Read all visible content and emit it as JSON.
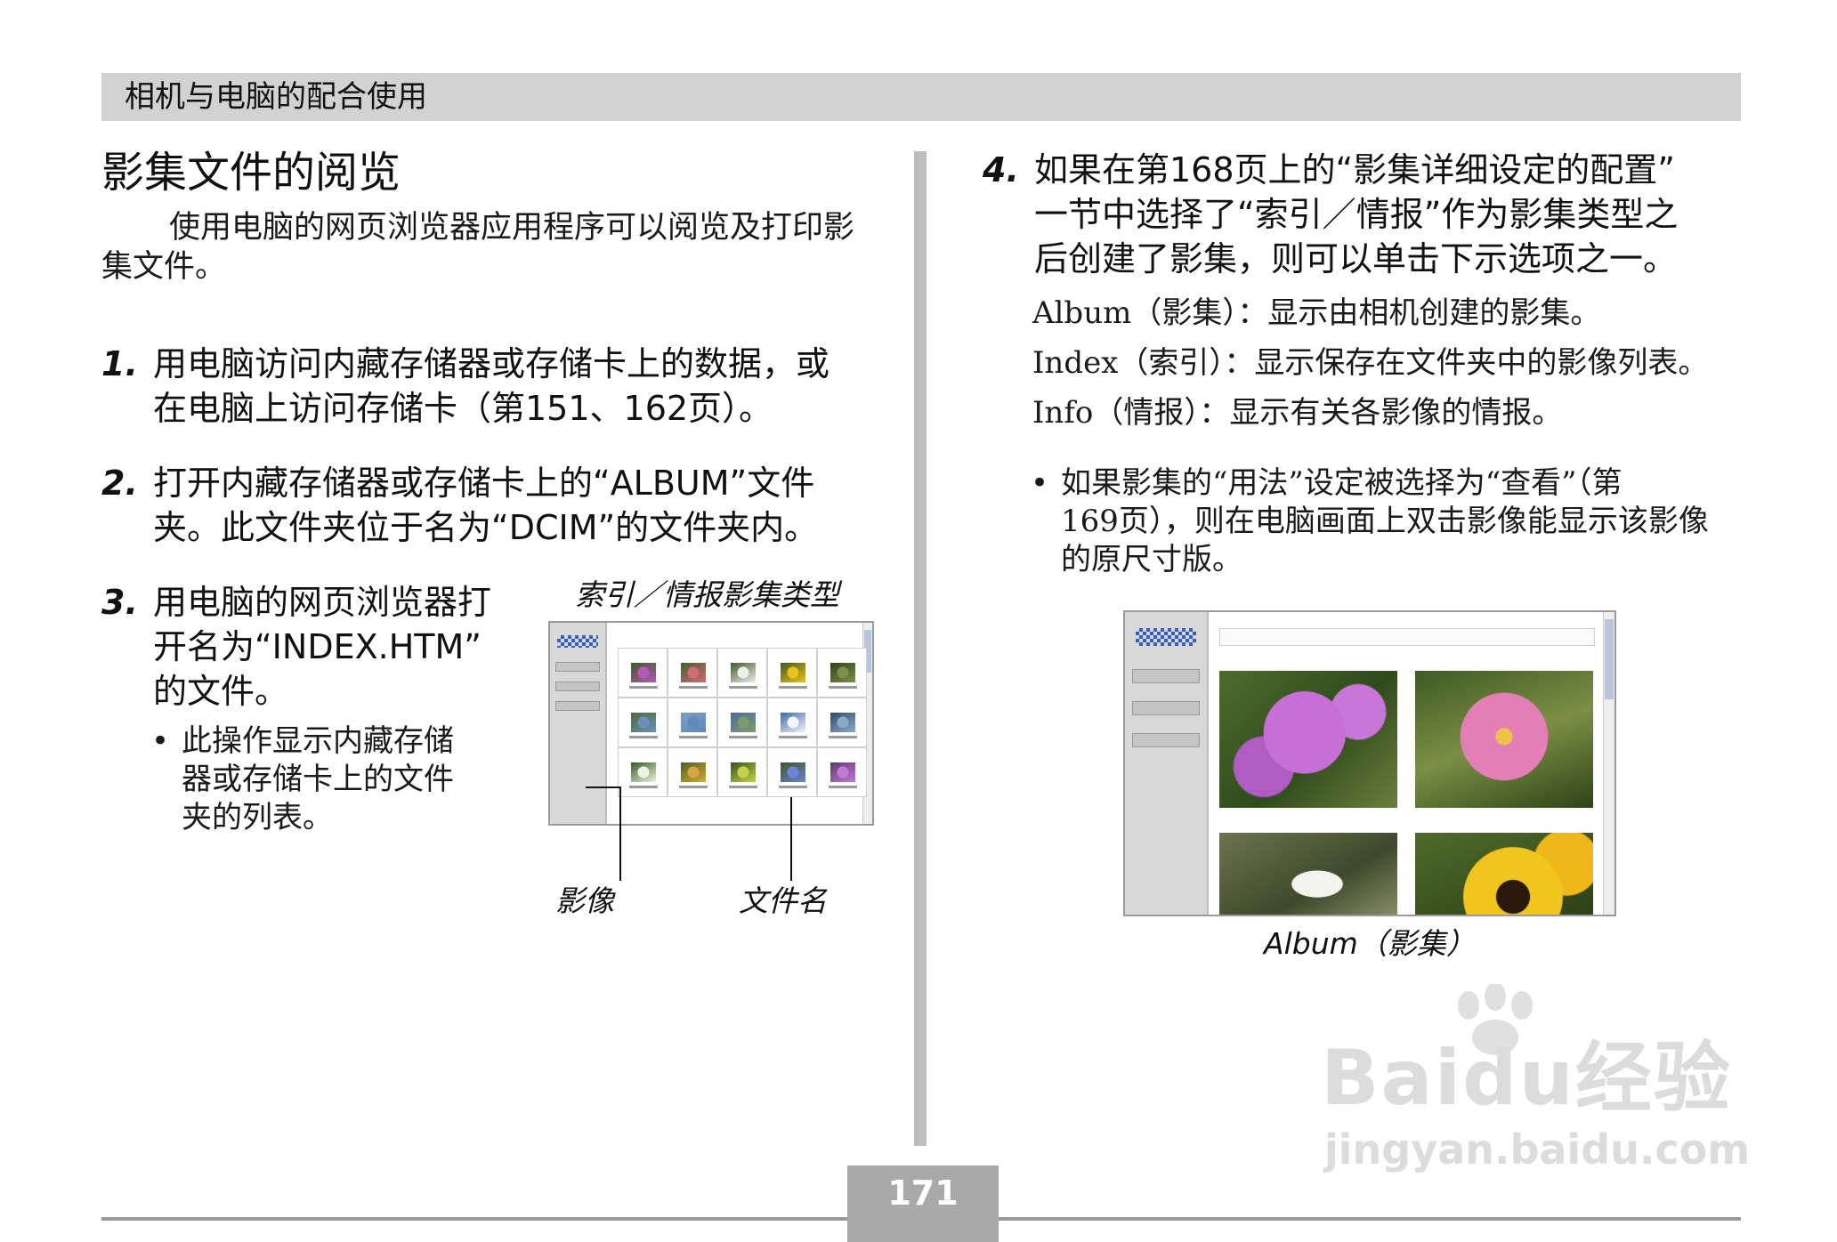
{
  "header": {
    "section": "相机与电脑的配合使用"
  },
  "title": "影集文件的阅览",
  "intro": "使用电脑的网页浏览器应用程序可以阅览及打印影集文件。",
  "steps": [
    {
      "num": "1.",
      "lines": [
        "用电脑访问内藏存储器或存储卡上的数据，或",
        "在电脑上访问存储卡（第151、162页）。"
      ]
    },
    {
      "num": "2.",
      "lines": [
        "打开内藏存储器或存储卡上的“ALBUM”文件",
        "夹。此文件夹位于名为“DCIM”的文件夹内。"
      ]
    },
    {
      "num": "3.",
      "lines": [
        "用电脑的网页浏览器打",
        "开名为“INDEX.HTM”",
        "的文件。"
      ]
    },
    {
      "num": "4.",
      "lines": [
        "如果在第168页上的“影集详细设定的配置”",
        "一节中选择了“索引／情报”作为影集类型之",
        "后创建了影集，则可以单击下示选项之一。"
      ]
    }
  ],
  "step3_bullet": {
    "symbol": "•",
    "lines": [
      "此操作显示内藏存储",
      "器或存储卡上的文件",
      "夹的列表。"
    ]
  },
  "index_figure": {
    "title": "索引／情报影集类型",
    "label_image": "影像",
    "label_filename": "文件名"
  },
  "options": [
    "Album（影集）：显示由相机创建的影集。",
    "Index（索引）：显示保存在文件夹中的影像列表。",
    "Info（情报）：显示有关各影像的情报。"
  ],
  "step4_bullet": {
    "symbol": "•",
    "lines": [
      "如果影集的“用法”设定被选择为“查看”（第",
      "169页），则在电脑画面上双击影像能显示该影像",
      "的原尺寸版。"
    ]
  },
  "album_figure": {
    "caption": "Album（影集）"
  },
  "page_number": "171",
  "watermark": {
    "brand": "Baidu经验",
    "url": "jingyan.baidu.com"
  }
}
